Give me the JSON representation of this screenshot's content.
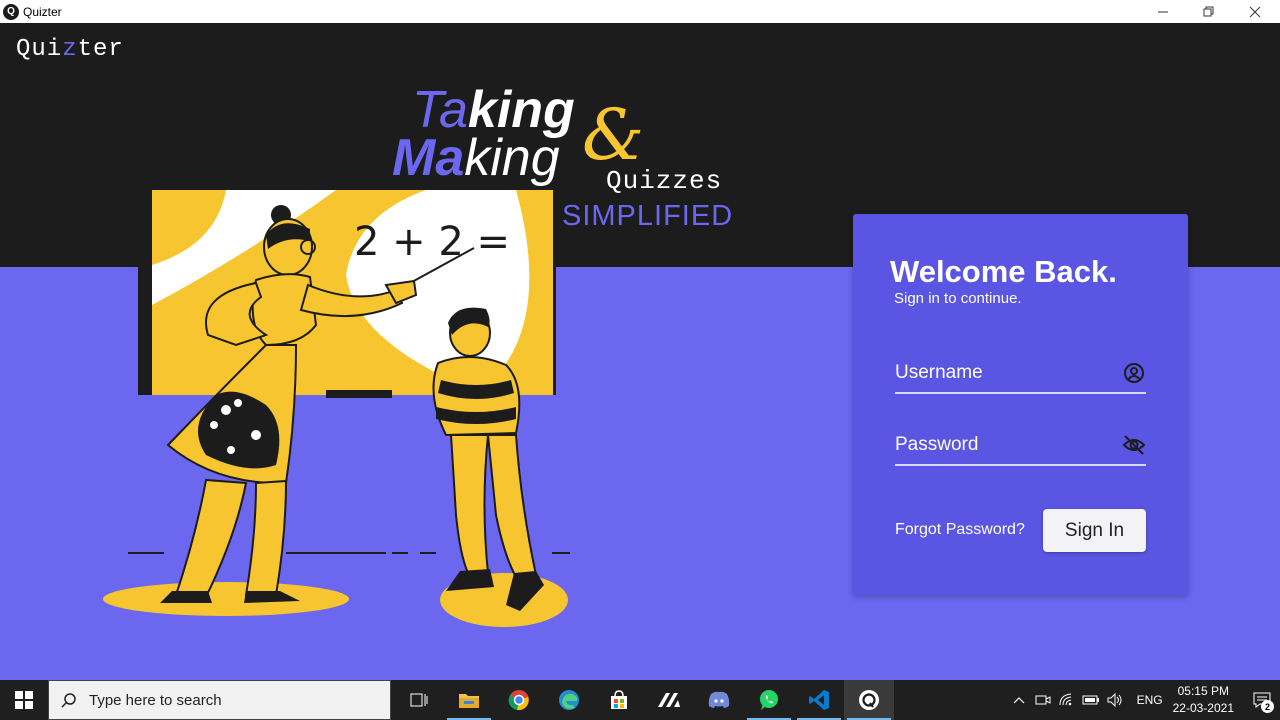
{
  "window": {
    "title": "Quizter"
  },
  "brand": {
    "prefix": "Qui",
    "highlight": "z",
    "suffix": "ter"
  },
  "hero": {
    "taking_a": "Ta",
    "taking_b": "king",
    "making_a": "Ma",
    "making_b": "king",
    "amp": "&",
    "quizzes": "Quizzes",
    "simplified": "SIMPLIFIED"
  },
  "illustration": {
    "board_text": "2 + 2 ="
  },
  "login": {
    "welcome": "Welcome Back.",
    "subtitle": "Sign in to continue.",
    "username_placeholder": "Username",
    "password_placeholder": "Password",
    "forgot": "Forgot Password?",
    "signin": "Sign In"
  },
  "taskbar": {
    "search_placeholder": "Type here to search",
    "language": "ENG",
    "time": "05:15 PM",
    "date": "22-03-2021",
    "notification_count": "2"
  },
  "colors": {
    "accent": "#6b67ef",
    "card": "#5a55e3",
    "dark": "#1c1c1c",
    "yellow": "#f7c530"
  }
}
